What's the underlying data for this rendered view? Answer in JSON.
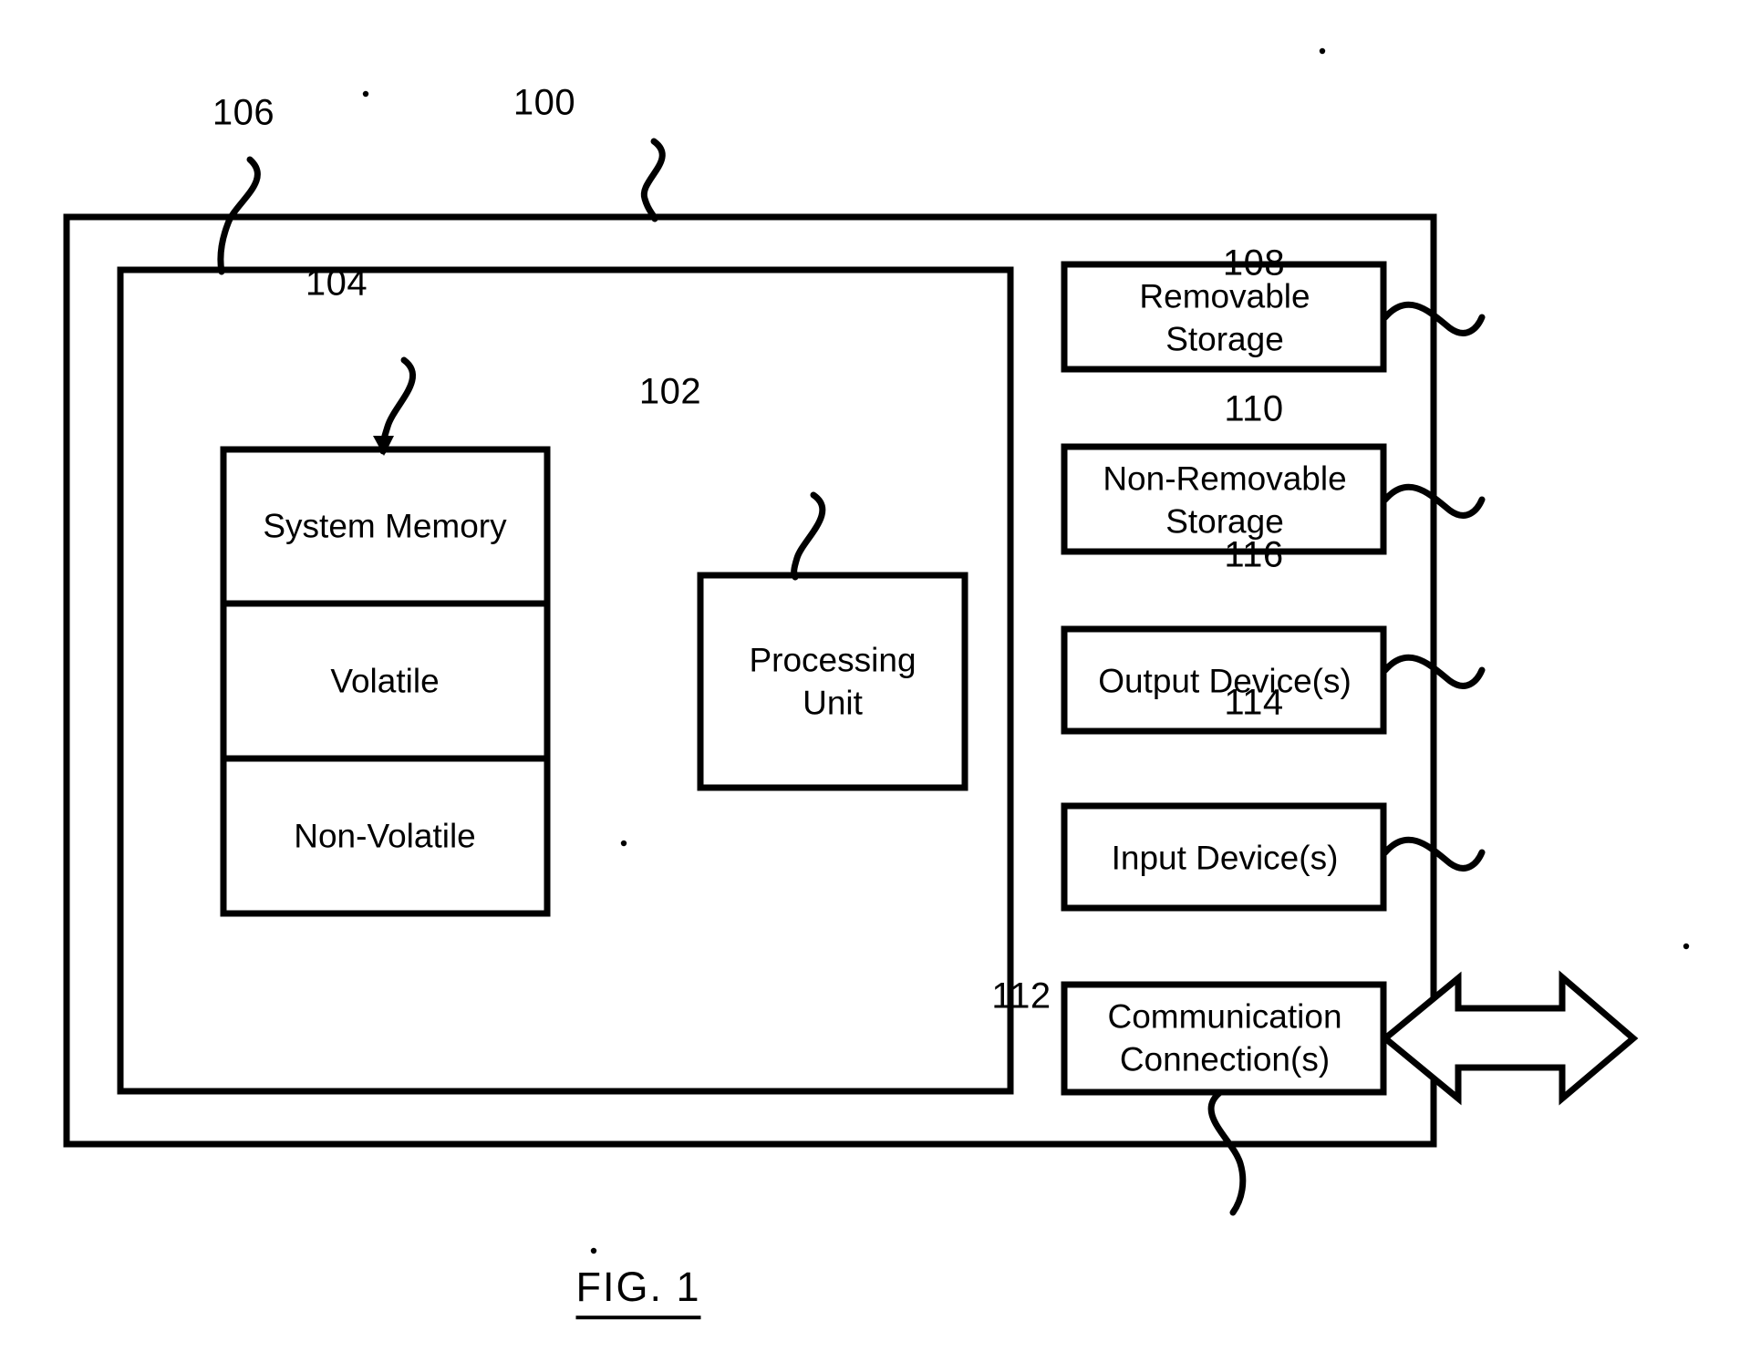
{
  "figure": {
    "caption": "FIG. 1",
    "system_ref": "100",
    "inner_ref": "106",
    "memory_ref": "104",
    "processing_ref": "102"
  },
  "memory_block": {
    "title": "System Memory",
    "rows": [
      {
        "label": "Volatile"
      },
      {
        "label": "Non-Volatile"
      }
    ]
  },
  "processing_unit": {
    "line1": "Processing",
    "line2": "Unit"
  },
  "peripherals": [
    {
      "line1": "Removable",
      "line2": "Storage",
      "ref": "108"
    },
    {
      "line1": "Non-Removable",
      "line2": "Storage",
      "ref": "110"
    },
    {
      "line1": "Output Device(s)",
      "line2": "",
      "ref": "116"
    },
    {
      "line1": "Input Device(s)",
      "line2": "",
      "ref": "114"
    },
    {
      "line1": "Communication",
      "line2": "Connection(s)",
      "ref": "112"
    }
  ],
  "colors": {
    "stroke": "#000000",
    "background": "#ffffff"
  }
}
